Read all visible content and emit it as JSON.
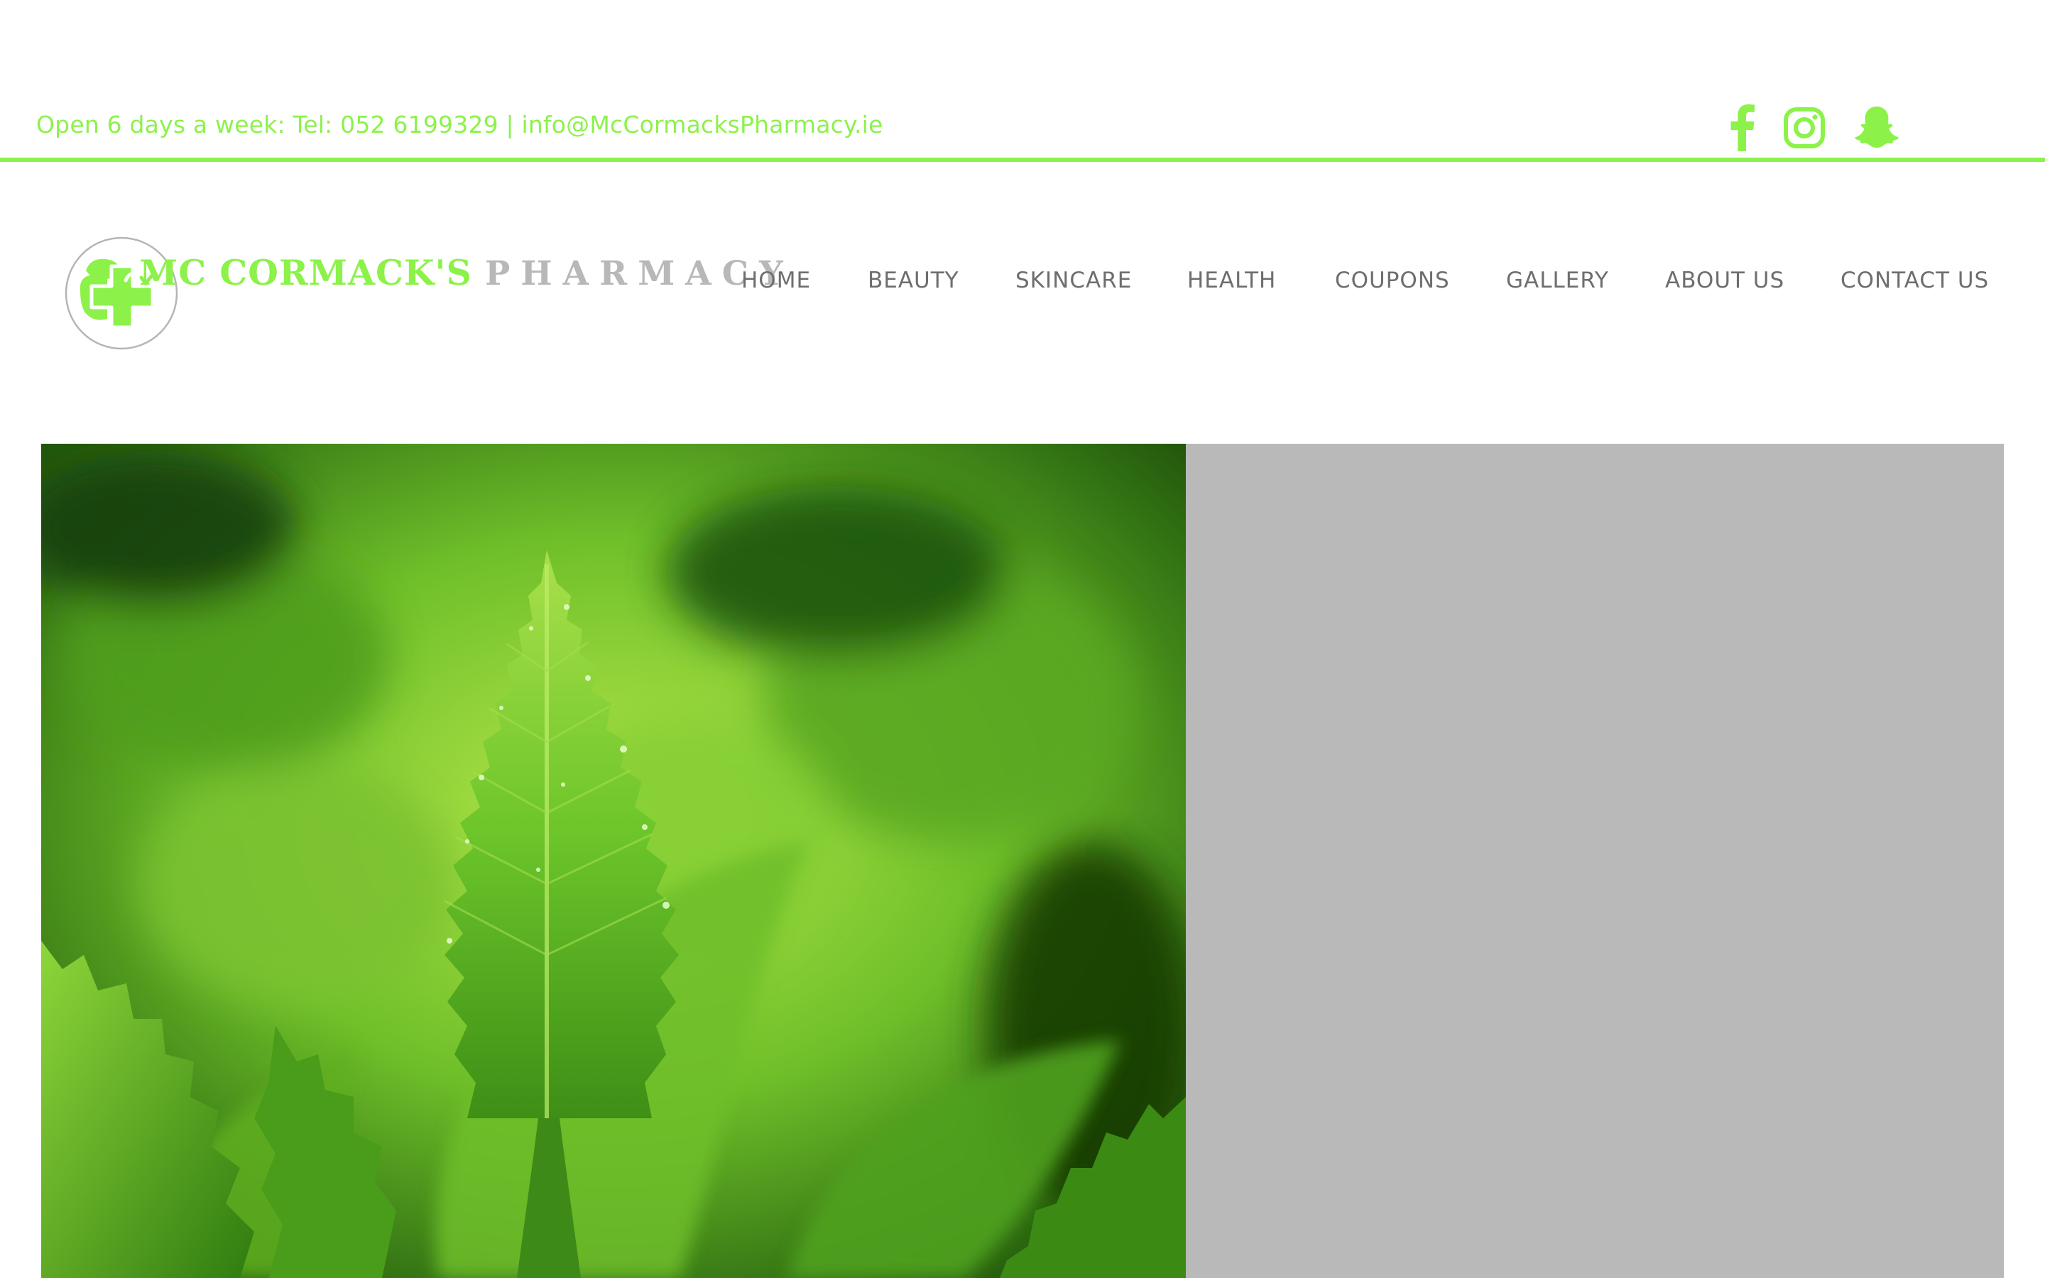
{
  "topbar": {
    "contact_text": "Open 6 days a week:  Tel: 052 6199329 | info@McCormacksPharmacy.ie",
    "accent_color": "#8cf24a",
    "social": [
      {
        "icon": "facebook-icon"
      },
      {
        "icon": "instagram-icon"
      },
      {
        "icon": "snapchat-icon"
      }
    ]
  },
  "logo": {
    "main": "MC CORMACK'S",
    "sub": "PHARMACY",
    "badge_icon": "pharmacy-cross-icon"
  },
  "nav": {
    "items": [
      {
        "label": "HOME"
      },
      {
        "label": "BEAUTY"
      },
      {
        "label": "SKINCARE"
      },
      {
        "label": "HEALTH"
      },
      {
        "label": "COUPONS"
      },
      {
        "label": "GALLERY"
      },
      {
        "label": "ABOUT US"
      },
      {
        "label": "CONTACT US"
      }
    ]
  },
  "hero": {
    "image": "green-nettle-leaf-photo",
    "panel_color": "#b9b9b9"
  }
}
